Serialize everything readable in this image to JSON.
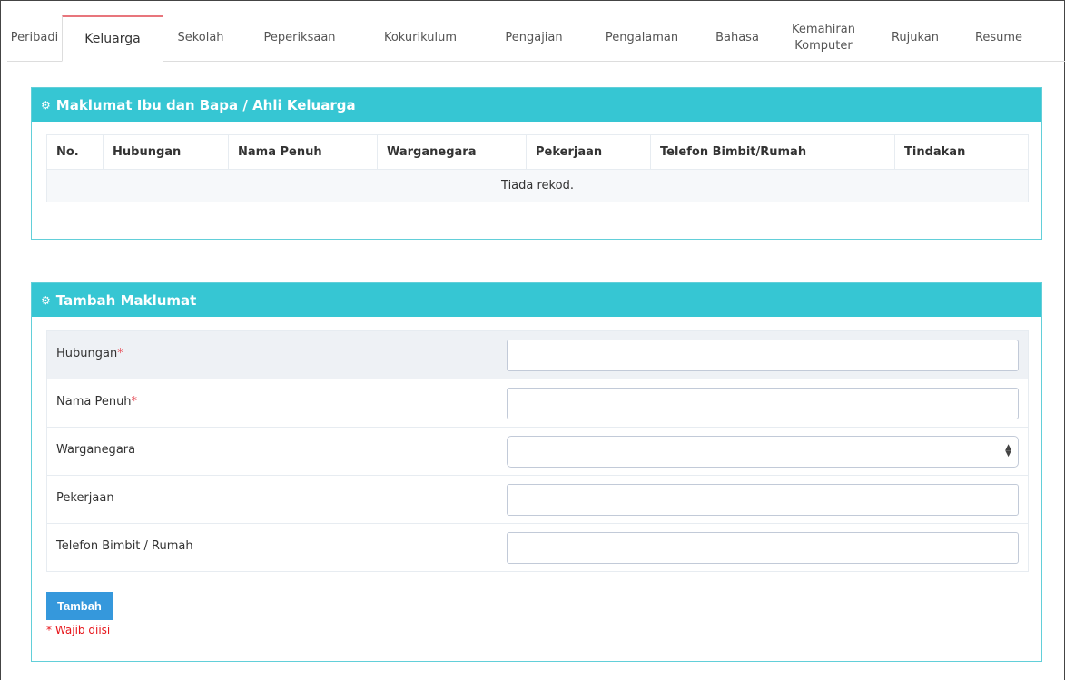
{
  "tabs": [
    {
      "label": "Peribadi"
    },
    {
      "label": "Keluarga",
      "active": true
    },
    {
      "label": "Sekolah"
    },
    {
      "label": "Peperiksaan"
    },
    {
      "label": "Kokurikulum"
    },
    {
      "label": "Pengajian"
    },
    {
      "label": "Pengalaman"
    },
    {
      "label": "Bahasa"
    },
    {
      "label": "Kemahiran Komputer"
    },
    {
      "label": "Rujukan"
    },
    {
      "label": "Resume"
    }
  ],
  "family_panel": {
    "title": "Maklumat Ibu dan Bapa / Ahli Keluarga",
    "columns": [
      "No.",
      "Hubungan",
      "Nama Penuh",
      "Warganegara",
      "Pekerjaan",
      "Telefon Bimbit/Rumah",
      "Tindakan"
    ],
    "empty_text": "Tiada rekod."
  },
  "add_panel": {
    "title": "Tambah Maklumat",
    "fields": {
      "hubungan": {
        "label": "Hubungan",
        "required": "*",
        "value": ""
      },
      "nama": {
        "label": "Nama Penuh",
        "required": "*",
        "value": ""
      },
      "warganegara": {
        "label": "Warganegara",
        "value": ""
      },
      "pekerjaan": {
        "label": "Pekerjaan",
        "value": ""
      },
      "telefon": {
        "label": "Telefon Bimbit / Rumah",
        "value": ""
      }
    },
    "submit_label": "Tambah",
    "required_note": "* Wajib diisi"
  },
  "icons": {
    "panel": "gears-icon",
    "select": "updown-arrows-icon"
  },
  "colors": {
    "panel_header": "#36c6d3",
    "active_tab_accent": "#e8757c",
    "button": "#3598dc",
    "required": "#e7505a"
  }
}
